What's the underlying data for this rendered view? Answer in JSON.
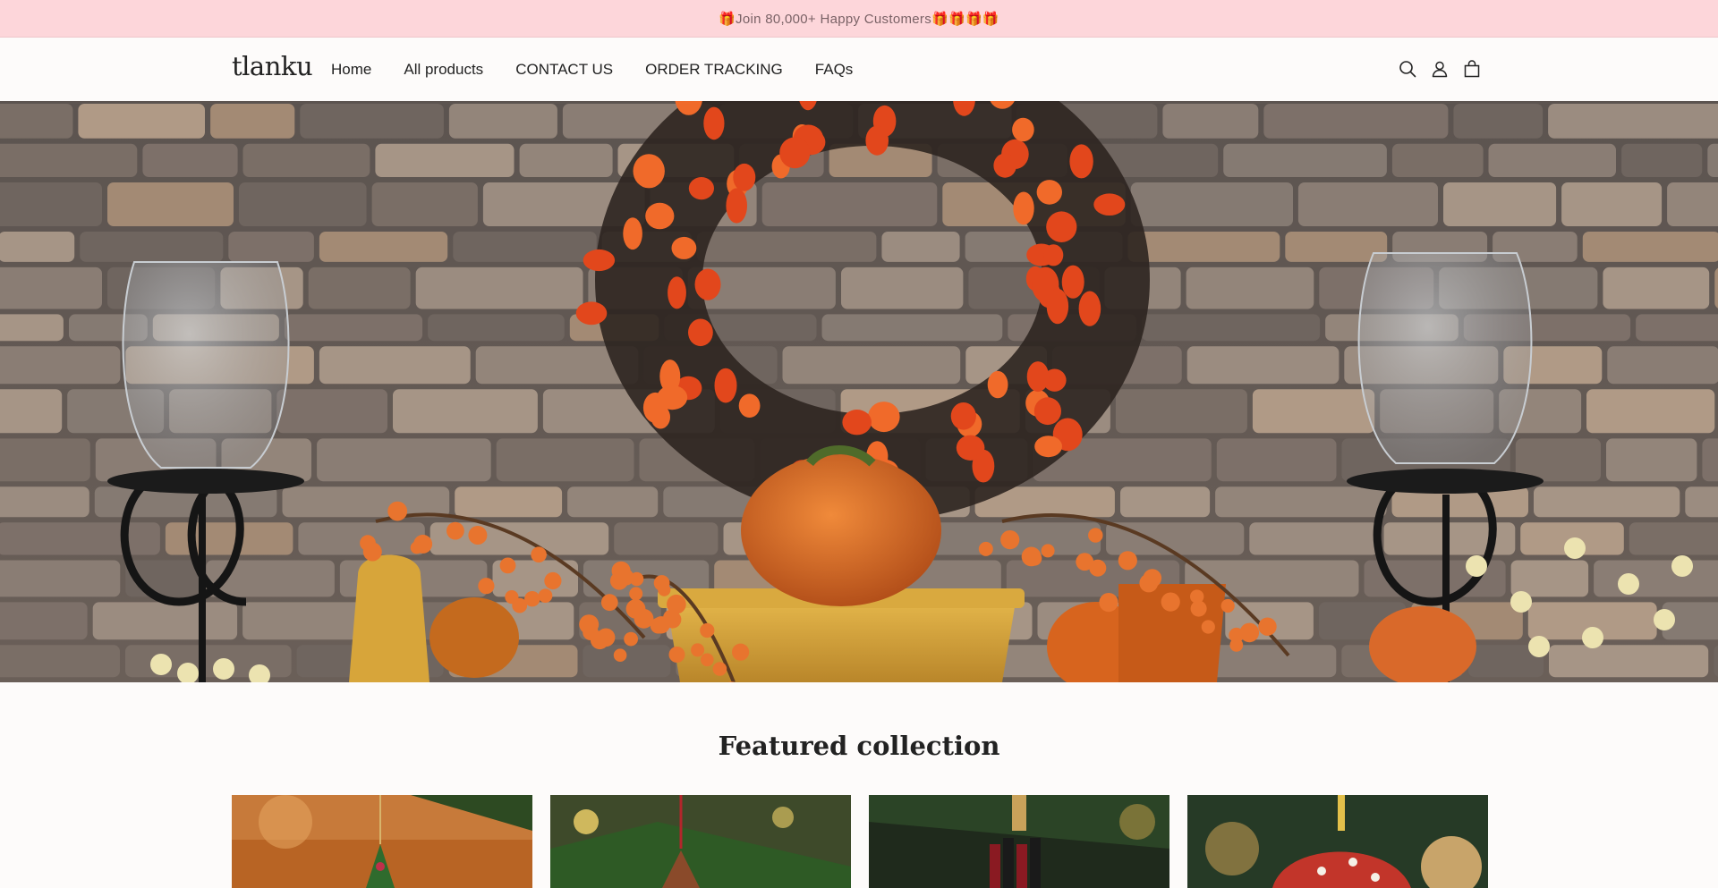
{
  "announcement": {
    "text": "🎁Join 80,000+ Happy Customers🎁🎁🎁🎁"
  },
  "header": {
    "logo": "tlanku",
    "nav": [
      {
        "label": "Home"
      },
      {
        "label": "All products"
      },
      {
        "label": "CONTACT US"
      },
      {
        "label": "ORDER TRACKING"
      },
      {
        "label": "FAQs"
      }
    ],
    "icons": [
      "search-icon",
      "account-icon",
      "cart-icon"
    ]
  },
  "hero": {
    "image": "autumn-mantel-stone-wall"
  },
  "featured": {
    "title": "Featured collection",
    "products": [
      {
        "image": "christmas-tree-ornament"
      },
      {
        "image": "gingerbread-house-ornament"
      },
      {
        "image": "lipstick-tree-ornament"
      },
      {
        "image": "mushroom-ornament"
      }
    ]
  },
  "colors": {
    "announcement_bg": "#fdd6da",
    "page_bg": "#fdfbfa",
    "text": "#222222"
  }
}
